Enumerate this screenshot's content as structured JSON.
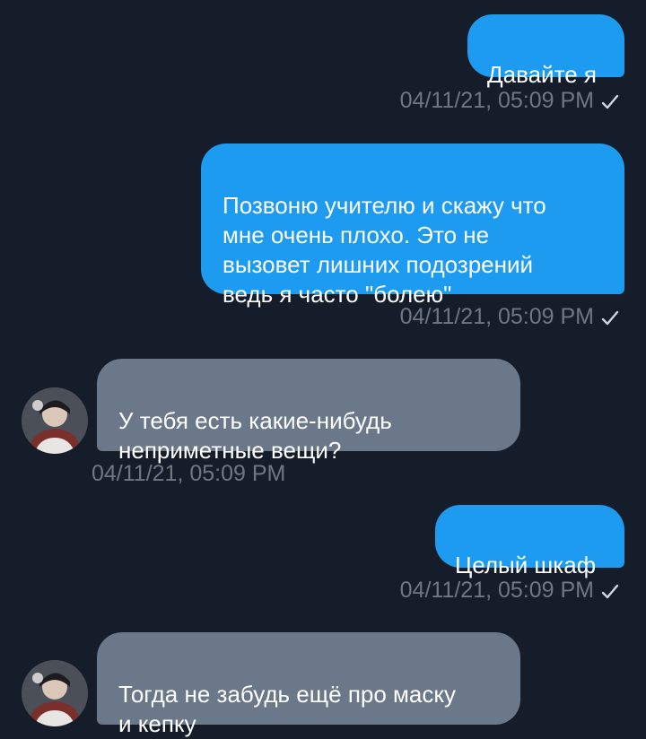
{
  "colors": {
    "background": "#141d29",
    "outgoing_bubble": "#1d9bf0",
    "incoming_bubble": "#6b7889",
    "timestamp": "#6e7885"
  },
  "messages": [
    {
      "direction": "outgoing",
      "text": "Давайте я",
      "time": "04/11/21, 05:09 PM",
      "status_icon": "check-icon"
    },
    {
      "direction": "outgoing",
      "text": "Позвоню учителю и скажу что\nмне очень плохо. Это не\nвызовет лишних подозрений\nведь я часто \"болею\"",
      "time": "04/11/21, 05:09 PM",
      "status_icon": "check-icon"
    },
    {
      "direction": "incoming",
      "text": "У тебя есть какие-нибудь\nнеприметные вещи?",
      "time": "04/11/21, 05:09 PM",
      "avatar_icon": "avatar"
    },
    {
      "direction": "outgoing",
      "text": "Целый шкаф",
      "time": "04/11/21, 05:09 PM",
      "status_icon": "check-icon"
    },
    {
      "direction": "incoming",
      "text": "Тогда не забудь ещё про маску\nи кепку",
      "avatar_icon": "avatar"
    }
  ]
}
